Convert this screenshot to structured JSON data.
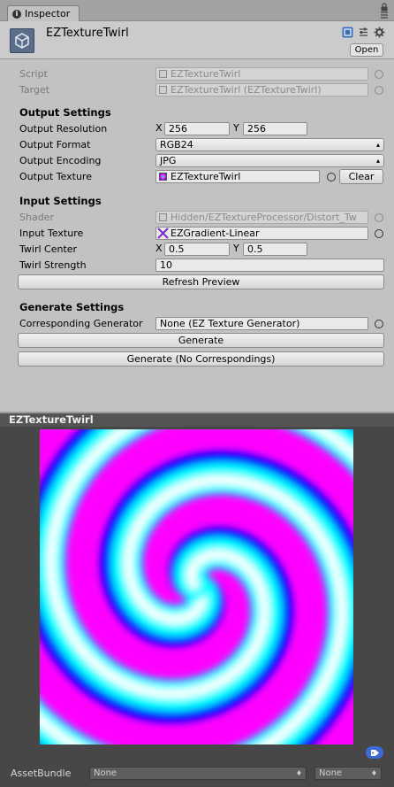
{
  "tab": {
    "title": "Inspector"
  },
  "header": {
    "object_name": "EZTextureTwirl",
    "open_label": "Open"
  },
  "script_row": {
    "label": "Script",
    "value": "EZTextureTwirl"
  },
  "target_row": {
    "label": "Target",
    "value": "EZTextureTwirl (EZTextureTwirl)"
  },
  "output_settings": {
    "title": "Output Settings",
    "resolution": {
      "label": "Output Resolution",
      "x_label": "X",
      "x": "256",
      "y_label": "Y",
      "y": "256"
    },
    "format": {
      "label": "Output Format",
      "value": "RGB24"
    },
    "encoding": {
      "label": "Output Encoding",
      "value": "JPG"
    },
    "texture": {
      "label": "Output Texture",
      "value": "EZTextureTwirl",
      "clear_label": "Clear"
    }
  },
  "input_settings": {
    "title": "Input Settings",
    "shader": {
      "label": "Shader",
      "value": "Hidden/EZTextureProcessor/Distort_Tw"
    },
    "input_texture": {
      "label": "Input Texture",
      "value": "EZGradient-Linear"
    },
    "twirl_center": {
      "label": "Twirl Center",
      "x_label": "X",
      "x": "0.5",
      "y_label": "Y",
      "y": "0.5"
    },
    "twirl_strength": {
      "label": "Twirl Strength",
      "value": "10"
    },
    "refresh_label": "Refresh Preview"
  },
  "generate_settings": {
    "title": "Generate Settings",
    "generator": {
      "label": "Corresponding Generator",
      "value": "None (EZ Texture Generator)"
    },
    "generate_label": "Generate",
    "generate_nc_label": "Generate (No Correspondings)"
  },
  "preview": {
    "title": "EZTextureTwirl"
  },
  "asset_bundle": {
    "label": "AssetBundle",
    "name": "None",
    "variant": "None"
  },
  "colors": {
    "magenta": "#ff00ff",
    "blue": "#0000ff",
    "cyan": "#00ffff",
    "white": "#ffffff"
  }
}
